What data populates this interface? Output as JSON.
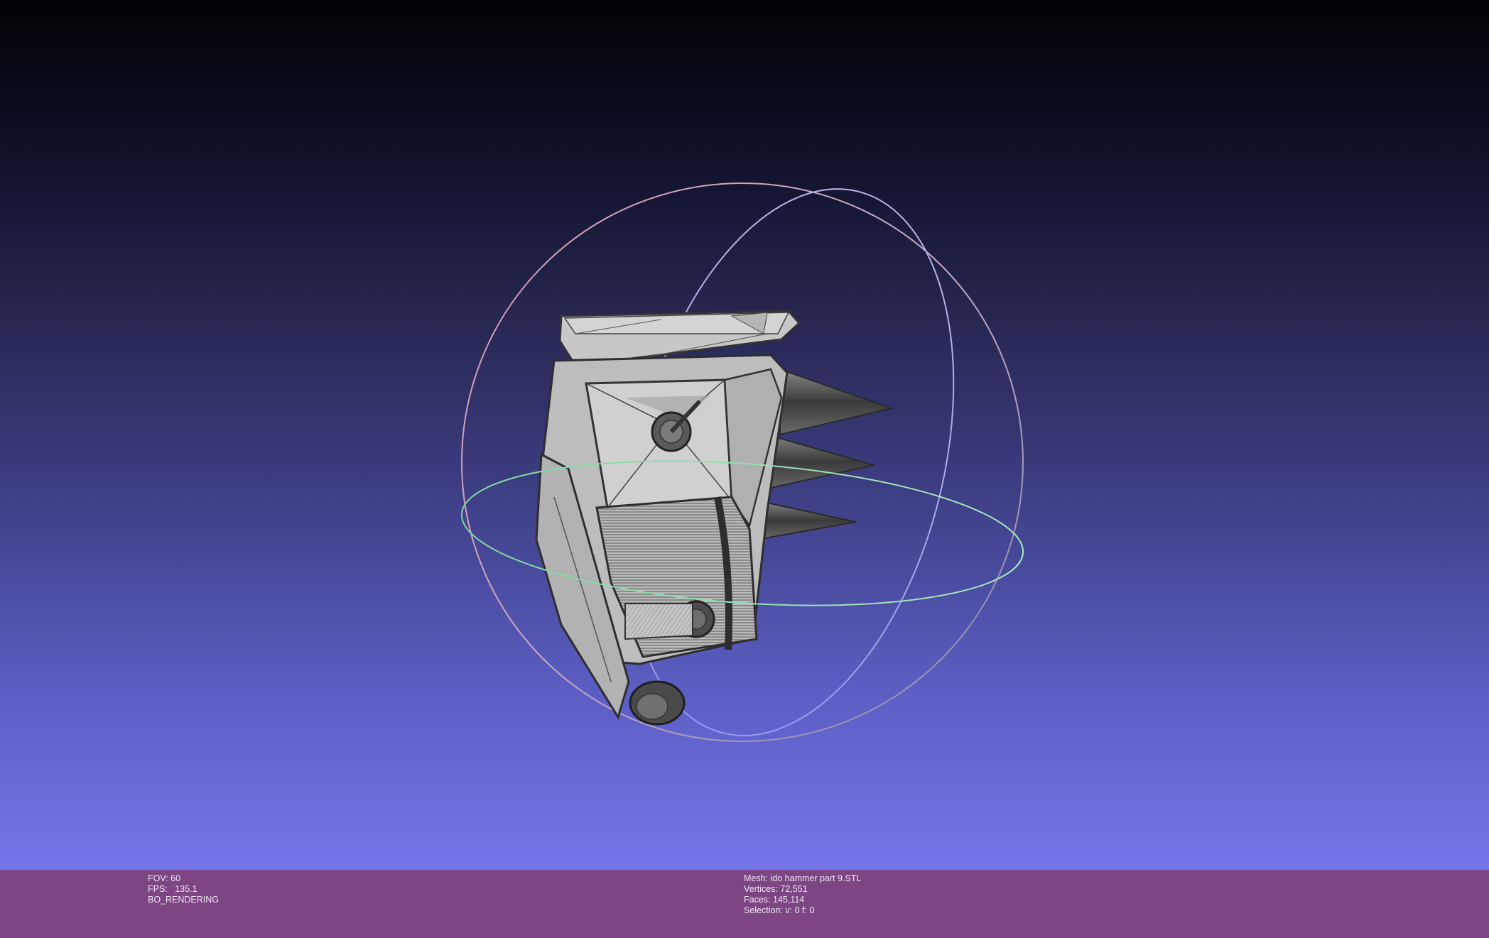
{
  "viewport": {
    "background_top": "#020205",
    "background_bottom": "#7576ea",
    "trackball_colors": {
      "x_ring": "#9b9bff",
      "y_ring": "#88e0a8",
      "z_ring": "#d9a3b8"
    }
  },
  "info_left": {
    "fov": "FOV: 60",
    "fps": "FPS:   135.1",
    "render_mode": "BO_RENDERING"
  },
  "info_right": {
    "mesh": "Mesh: ido hammer part 9.STL",
    "vertices": "Vertices: 72,551",
    "faces": "Faces: 145,114",
    "selection": "Selection: v: 0 f: 0"
  },
  "info_bar_color": "#7e4585"
}
